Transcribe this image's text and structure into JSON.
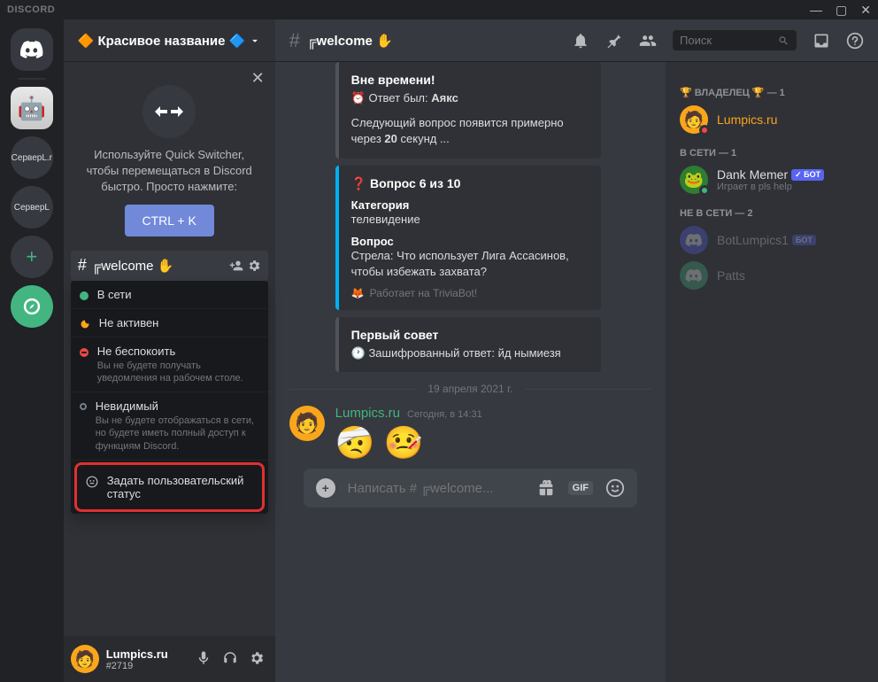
{
  "window": {
    "title": "DISCORD"
  },
  "serverList": {
    "servers": [
      "СерверL.r",
      "СерверL"
    ],
    "robot_emoji": "🤖"
  },
  "sidebar": {
    "serverName": "🔶 Красивое название 🔷",
    "quickSwitcher": {
      "text": "Используйте Quick Switcher, чтобы перемещаться в Discord быстро. Просто нажмите:",
      "button": "CTRL + K"
    },
    "activeChannel": {
      "name": "╔welcome",
      "emoji": "✋"
    },
    "statusMenu": {
      "online": {
        "label": "В сети"
      },
      "idle": {
        "label": "Не активен"
      },
      "dnd": {
        "label": "Не беспокоить",
        "desc": "Вы не будете получать уведомления на рабочем столе."
      },
      "invisible": {
        "label": "Невидимый",
        "desc": "Вы не будете отображаться в сети, но будете иметь полный доступ к функциям Discord."
      },
      "custom": {
        "label": "Задать пользовательский статус"
      }
    },
    "user": {
      "name": "Lumpics.ru",
      "tag": "#2719"
    }
  },
  "channelHeader": {
    "hash": "#",
    "name": "╔welcome",
    "emoji": "✋",
    "searchPlaceholder": "Поиск"
  },
  "messages": {
    "embed1": {
      "title": "Вне времени!",
      "answerPrefix": "⏰ Ответ был:",
      "answerValue": "Аякс",
      "nextPrefix": "Следующий вопрос появится примерно через",
      "nextBold": "20",
      "nextSuffix": " секунд ..."
    },
    "embed2": {
      "title": "❓ Вопрос 6 из 10",
      "catLabel": "Категория",
      "catValue": "телевидение",
      "qLabel": "Вопрос",
      "qValue": "Стрела: Что использует Лига Ассасинов, чтобы избежать захвата?",
      "footer": "Работает на TriviaBot!"
    },
    "embed3": {
      "title": "Первый совет",
      "hint": "🕐 Зашифрованный ответ: йд нымиезя"
    },
    "dateDivider": "19 апреля 2021 г.",
    "userMessage": {
      "author": "Lumpics.ru",
      "time": "Сегодня, в 14:31",
      "emoji1": "🤕",
      "emoji2": "🤒"
    },
    "inputPlaceholder": "Написать # ╔welcome..."
  },
  "members": {
    "ownerCat": "🏆 ВЛАДЕЛЕЦ 🏆 — 1",
    "owner": "Lumpics.ru",
    "onlineCat": "В СЕТИ — 1",
    "dankMemer": {
      "name": "Dank Memer",
      "botTag": "✓ БОТ",
      "activity": "Играет в pls help"
    },
    "offlineCat": "НЕ В СЕТИ — 2",
    "offline1": {
      "name": "BotLumpics1",
      "tag": "БОТ"
    },
    "offline2": "Patts"
  }
}
